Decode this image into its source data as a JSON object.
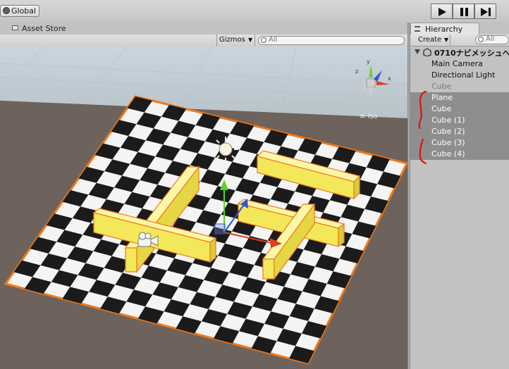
{
  "toolbar": {
    "global_label": "Global",
    "play_icon": "play-icon",
    "pause_icon": "pause-icon",
    "step_icon": "step-icon"
  },
  "scene_tabs": {
    "asset_store_label": "Asset Store"
  },
  "scene_toolbar": {
    "gizmos_label": "Gizmos",
    "search_placeholder": "All"
  },
  "scene_view": {
    "projection_label": "Iso",
    "colors": {
      "selection_outline": "#f07a1a",
      "cube_fill": "#f3e85a",
      "ground": "#6d635c",
      "sky": "#c7d3dd"
    }
  },
  "hierarchy": {
    "tab_label": "Hierarchy",
    "create_label": "Create",
    "search_placeholder": "All",
    "scene_name": "0710ナビメッシュへ",
    "items": [
      {
        "label": "Main Camera",
        "state": "normal"
      },
      {
        "label": "Directional Light",
        "state": "normal"
      },
      {
        "label": "Cube",
        "state": "disabled"
      },
      {
        "label": "Plane",
        "state": "selected"
      },
      {
        "label": "Cube",
        "state": "selected"
      },
      {
        "label": "Cube (1)",
        "state": "selected"
      },
      {
        "label": "Cube (2)",
        "state": "selected"
      },
      {
        "label": "Cube (3)",
        "state": "selected"
      },
      {
        "label": "Cube (4)",
        "state": "selected"
      }
    ]
  }
}
